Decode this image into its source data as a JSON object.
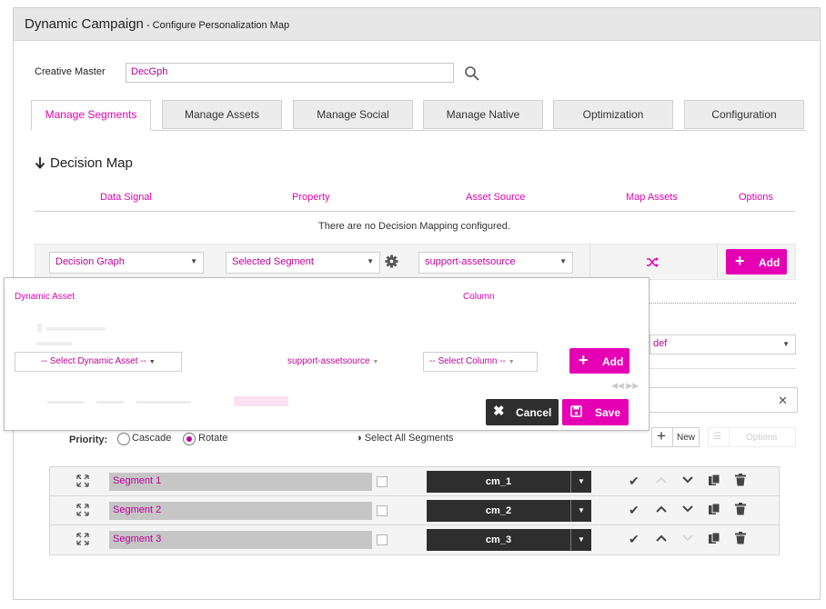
{
  "header": {
    "title": "Dynamic Campaign",
    "subtitle": " - Configure Personalization Map"
  },
  "creative": {
    "label": "Creative Master",
    "value": "DecGph"
  },
  "tabs": [
    {
      "label": "Manage Segments",
      "active": true
    },
    {
      "label": "Manage Assets",
      "active": false
    },
    {
      "label": "Manage Social",
      "active": false
    },
    {
      "label": "Manage Native",
      "active": false
    },
    {
      "label": "Optimization",
      "active": false
    },
    {
      "label": "Configuration",
      "active": false
    }
  ],
  "decision_map": {
    "title": "Decision Map",
    "columns": [
      "Data Signal",
      "Property",
      "Asset Source",
      "Map Assets",
      "Options"
    ],
    "empty_message": "There are no Decision Mapping configured.",
    "row": {
      "data_signal": "Decision Graph",
      "property": "Selected Segment",
      "asset_source": "support-assetsource",
      "add_label": "Add"
    }
  },
  "popup": {
    "dynamic_asset_label": "Dynamic Asset",
    "column_label": "Column",
    "dynamic_asset_select": "-- Select Dynamic Asset --",
    "asset_source_select": "support-assetsource",
    "column_select": "-- Select Column --",
    "add_label": "Add",
    "cancel_label": "Cancel",
    "save_label": "Save"
  },
  "background": {
    "def_select": "def"
  },
  "segments_toolbar": {
    "priority_label": "Priority:",
    "cascade_label": "Cascade",
    "rotate_label": "Rotate",
    "rotate_selected": true,
    "select_all_label": "Select All Segments",
    "new_label": "New",
    "options_label": "Options"
  },
  "segments": [
    {
      "name": "Segment 1",
      "creative": "cm_1"
    },
    {
      "name": "Segment 2",
      "creative": "cm_2"
    },
    {
      "name": "Segment 3",
      "creative": "cm_3"
    }
  ],
  "colors": {
    "accent": "#e600b4",
    "dark": "#2e2e2e"
  }
}
